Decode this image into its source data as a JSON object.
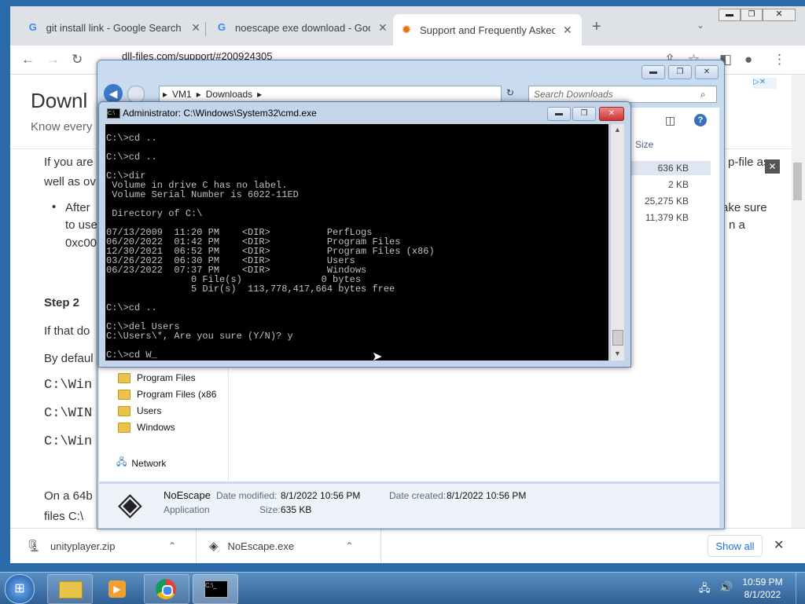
{
  "browser": {
    "tabs": [
      {
        "title": "git install link - Google Search",
        "favicon": "G"
      },
      {
        "title": "noescape exe download - Googl",
        "favicon": "G"
      },
      {
        "title": "Support and Frequently Asked Q",
        "favicon": "gear"
      }
    ],
    "url": "dll-files.com/support/#200924305"
  },
  "page": {
    "heading": "Downl",
    "subheading": "Know every",
    "para1_a": "If you are",
    "para1_b": "well as ov",
    "para1_right": "p-file as",
    "bullet_a": "After",
    "bullet_b": "to use",
    "bullet_c": "0xc00",
    "bullet_right1": "ake sure",
    "bullet_right2": "n a",
    "step2": "Step 2",
    "step2_text": "If that do",
    "default_text": "By defaul",
    "path1": "C:\\Win",
    "path2": "C:\\WIN",
    "path3": "C:\\Win",
    "on64": "On a 64b",
    "files": "files C:\\"
  },
  "downloads": {
    "items": [
      "unityplayer.zip",
      "NoEscape.exe"
    ],
    "show_all": "Show all"
  },
  "explorer": {
    "breadcrumb": [
      "VM1",
      "Downloads"
    ],
    "search_placeholder": "Search Downloads",
    "size_header": "Size",
    "sizes": [
      "636 KB",
      "2 KB",
      "25,275 KB",
      "11,379 KB"
    ],
    "nav": [
      "Program Files",
      "Program Files (x86",
      "Users",
      "Windows"
    ],
    "network": "Network",
    "details": {
      "name": "NoEscape",
      "type": "Application",
      "modified_label": "Date modified:",
      "modified": "8/1/2022 10:56 PM",
      "created_label": "Date created:",
      "created": "8/1/2022 10:56 PM",
      "size_label": "Size:",
      "size": "635 KB"
    }
  },
  "cmd": {
    "title": "Administrator: C:\\Windows\\System32\\cmd.exe",
    "lines": [
      "",
      "C:\\>cd ..",
      "",
      "C:\\>cd ..",
      "",
      "C:\\>dir",
      " Volume in drive C has no label.",
      " Volume Serial Number is 6022-11ED",
      "",
      " Directory of C:\\",
      "",
      "07/13/2009  11:20 PM    <DIR>          PerfLogs",
      "06/20/2022  01:42 PM    <DIR>          Program Files",
      "12/30/2021  06:52 PM    <DIR>          Program Files (x86)",
      "03/26/2022  06:30 PM    <DIR>          Users",
      "06/23/2022  07:37 PM    <DIR>          Windows",
      "               0 File(s)              0 bytes",
      "               5 Dir(s)  113,778,417,664 bytes free",
      "",
      "C:\\>cd ..",
      "",
      "C:\\>del Users",
      "C:\\Users\\*, Are you sure (Y/N)? y",
      "",
      "C:\\>cd W_"
    ]
  },
  "taskbar": {
    "time": "10:59 PM",
    "date": "8/1/2022"
  }
}
